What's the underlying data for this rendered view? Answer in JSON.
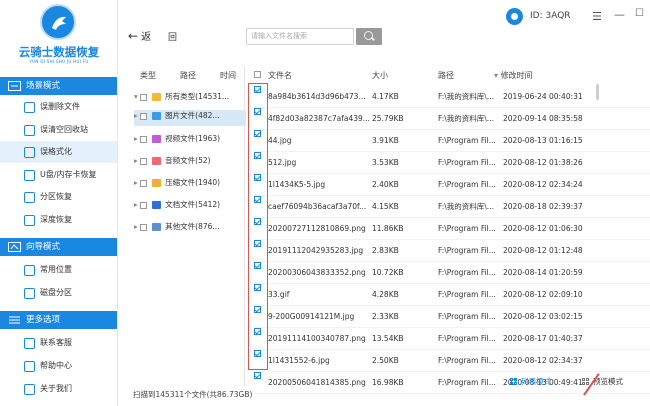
{
  "app": {
    "title": "云骑士数据恢复",
    "subtitle": "YUN QI SHI SHU JU HUI FU",
    "user_id": "ID: 3AQR"
  },
  "colors": {
    "accent": "#1a87e0",
    "highlight": "#d7e9f7",
    "annotation": "#d9534f"
  },
  "sidebar": {
    "sections": [
      {
        "label": "场景模式",
        "icon": "scene-icon",
        "items": [
          {
            "label": "误删除文件"
          },
          {
            "label": "误清空回收站"
          },
          {
            "label": "误格式化"
          },
          {
            "label": "U盘/内存卡恢复"
          },
          {
            "label": "分区恢复"
          },
          {
            "label": "深度恢复"
          }
        ]
      },
      {
        "label": "向导模式",
        "icon": "wizard-icon",
        "items": [
          {
            "label": "常用位置"
          },
          {
            "label": "磁盘分区"
          }
        ]
      },
      {
        "label": "更多选项",
        "icon": "more-icon",
        "items": [
          {
            "label": "联系客服"
          },
          {
            "label": "帮助中心"
          },
          {
            "label": "关于我们"
          }
        ]
      }
    ],
    "active_item": "误格式化"
  },
  "toolbar": {
    "back_label": "返",
    "up_label": "回",
    "search_placeholder": "请输入文件名搜索"
  },
  "type_panel": {
    "headers": [
      "类型",
      "路径",
      "时间"
    ],
    "rows": [
      {
        "label": "所有类型(14531...",
        "icon": "folder-icon"
      },
      {
        "label": "图片文件(482...",
        "icon": "image-icon"
      },
      {
        "label": "视频文件(1963)",
        "icon": "video-icon"
      },
      {
        "label": "音频文件(52)",
        "icon": "audio-icon"
      },
      {
        "label": "压缩文件(1940)",
        "icon": "archive-icon"
      },
      {
        "label": "文档文件(5412)",
        "icon": "document-icon"
      },
      {
        "label": "其他文件(876...",
        "icon": "other-file-icon"
      }
    ]
  },
  "file_table": {
    "headers": {
      "name": "文件名",
      "size": "大小",
      "path": "路径",
      "mtime": "修改时间"
    },
    "rows": [
      {
        "name": "8a984b3614d3d96b473...",
        "size": "4.17KB",
        "path": "F:\\我的资料库\\...",
        "mtime": "2019-06-24 00:40:31"
      },
      {
        "name": "4f82d03a82387c7afa439...",
        "size": "25.79KB",
        "path": "F:\\我的资料库\\...",
        "mtime": "2020-09-14 08:35:58"
      },
      {
        "name": "44.jpg",
        "size": "3.91KB",
        "path": "F:\\Program Fil...",
        "mtime": "2020-08-13 01:16:15"
      },
      {
        "name": "512.jpg",
        "size": "3.53KB",
        "path": "F:\\Program Fil...",
        "mtime": "2020-08-12 01:38:26"
      },
      {
        "name": "1l1434K5-5.jpg",
        "size": "2.40KB",
        "path": "F:\\Program Fil...",
        "mtime": "2020-08-12 02:34:24"
      },
      {
        "name": "caef76094b36acaf3a70f...",
        "size": "4.15KB",
        "path": "F:\\我的资料库\\...",
        "mtime": "2020-08-18 02:39:37"
      },
      {
        "name": "20200727112810869.png",
        "size": "11.86KB",
        "path": "F:\\Program Fil...",
        "mtime": "2020-08-12 01:06:30"
      },
      {
        "name": "20191112042935283.jpg",
        "size": "2.83KB",
        "path": "F:\\Program Fil...",
        "mtime": "2020-08-12 01:12:48"
      },
      {
        "name": "20200306043833352.png",
        "size": "10.72KB",
        "path": "F:\\Program Fil...",
        "mtime": "2020-08-14 01:20:59"
      },
      {
        "name": "33.gif",
        "size": "4.28KB",
        "path": "F:\\Program Fil...",
        "mtime": "2020-08-12 02:09:10"
      },
      {
        "name": "9-200G00914121M.jpg",
        "size": "2.33KB",
        "path": "F:\\Program Fil...",
        "mtime": "2020-08-12 03:02:15"
      },
      {
        "name": "20191114100340787.png",
        "size": "13.54KB",
        "path": "F:\\Program Fil...",
        "mtime": "2020-08-17 01:40:37"
      },
      {
        "name": "1l1431552-6.jpg",
        "size": "2.50KB",
        "path": "F:\\Program Fil...",
        "mtime": "2020-08-12 02:34:37"
      },
      {
        "name": "20200506041814385.png",
        "size": "16.98KB",
        "path": "F:\\Program Fil...",
        "mtime": "2020-08-13 00:49:41"
      }
    ]
  },
  "status": {
    "scan_text": "扫描到145311个文件(共86.73GB)"
  },
  "view_modes": {
    "list_label": "列表模式",
    "preview_label": "预览模式"
  }
}
